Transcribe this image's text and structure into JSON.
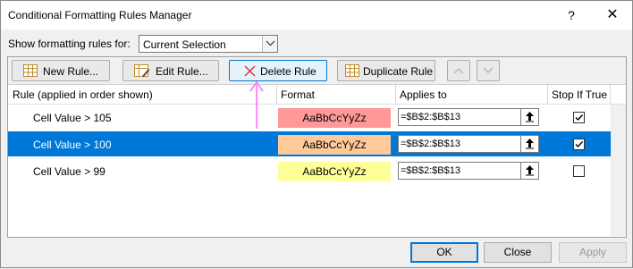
{
  "window": {
    "title": "Conditional Formatting Rules Manager",
    "help_glyph": "?",
    "close_glyph": "✕"
  },
  "show_for": {
    "label": "Show formatting rules for:",
    "value": "Current Selection"
  },
  "toolbar": {
    "new_rule": "New Rule...",
    "edit_rule": "Edit Rule...",
    "delete_rule": "Delete Rule",
    "duplicate_rule": "Duplicate Rule"
  },
  "grid": {
    "headers": {
      "rule": "Rule (applied in order shown)",
      "format": "Format",
      "applies_to": "Applies to",
      "stop_if_true": "Stop If True"
    },
    "rows": [
      {
        "rule": "Cell Value > 105",
        "format_preview": "AaBbCcYyZz",
        "format_color": "#ff9999",
        "applies_to": "=$B$2:$B$13",
        "stop_if_true": true,
        "selected": false
      },
      {
        "rule": "Cell Value > 100",
        "format_preview": "AaBbCcYyZz",
        "format_color": "#ffc999",
        "applies_to": "=$B$2:$B$13",
        "stop_if_true": true,
        "selected": true
      },
      {
        "rule": "Cell Value > 99",
        "format_preview": "AaBbCcYyZz",
        "format_color": "#ffff99",
        "applies_to": "=$B$2:$B$13",
        "stop_if_true": false,
        "selected": false
      }
    ]
  },
  "footer": {
    "ok": "OK",
    "close": "Close",
    "apply": "Apply"
  },
  "colors": {
    "selection": "#0078d7",
    "annotation_arrow": "#ff66ff"
  }
}
